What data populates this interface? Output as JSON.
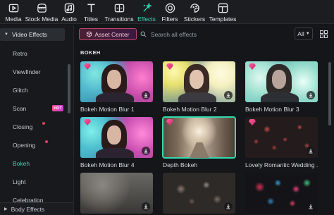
{
  "toolbar": {
    "items": [
      {
        "label": "Media",
        "icon": "media-icon"
      },
      {
        "label": "Stock Media",
        "icon": "stock-media-icon"
      },
      {
        "label": "Audio",
        "icon": "audio-icon"
      },
      {
        "label": "Titles",
        "icon": "titles-icon"
      },
      {
        "label": "Transitions",
        "icon": "transitions-icon"
      },
      {
        "label": "Effects",
        "icon": "effects-icon",
        "active": true
      },
      {
        "label": "Filters",
        "icon": "filters-icon"
      },
      {
        "label": "Stickers",
        "icon": "stickers-icon"
      },
      {
        "label": "Templates",
        "icon": "templates-icon"
      }
    ]
  },
  "sidebar": {
    "header": "Video Effects",
    "items": [
      {
        "label": "Retro"
      },
      {
        "label": "Viewfinder"
      },
      {
        "label": "Glitch"
      },
      {
        "label": "Scan",
        "badge": "HOT"
      },
      {
        "label": "Closing",
        "dot": true
      },
      {
        "label": "Opening",
        "dot": true
      },
      {
        "label": "Bokeh",
        "active": true
      },
      {
        "label": "Light"
      },
      {
        "label": "Celebration"
      }
    ],
    "footer": "Body Effects"
  },
  "main": {
    "asset_center": "Asset Center",
    "search_placeholder": "Search all effects",
    "filter_label": "All",
    "section_title": "BOKEH",
    "cards": [
      {
        "title": "Bokeh Motion Blur 1",
        "premium": true,
        "download": true
      },
      {
        "title": "Bokeh Motion Blur 2",
        "premium": true,
        "download": true
      },
      {
        "title": "Bokeh Motion Blur 3",
        "premium": true,
        "download": true
      },
      {
        "title": "Bokeh Motion Blur 4",
        "premium": true,
        "download": true
      },
      {
        "title": "Depth Bokeh",
        "premium": true,
        "download": false,
        "selected": true
      },
      {
        "title": "Lovely Romantic Wedding ...",
        "premium": true,
        "download": true
      },
      {
        "title": "",
        "premium": false,
        "download": true
      },
      {
        "title": "",
        "premium": false,
        "download": true
      },
      {
        "title": "",
        "premium": false,
        "download": true
      }
    ]
  },
  "colors": {
    "accent": "#35d9b0",
    "premium": "#e0306e",
    "background": "#141619"
  }
}
